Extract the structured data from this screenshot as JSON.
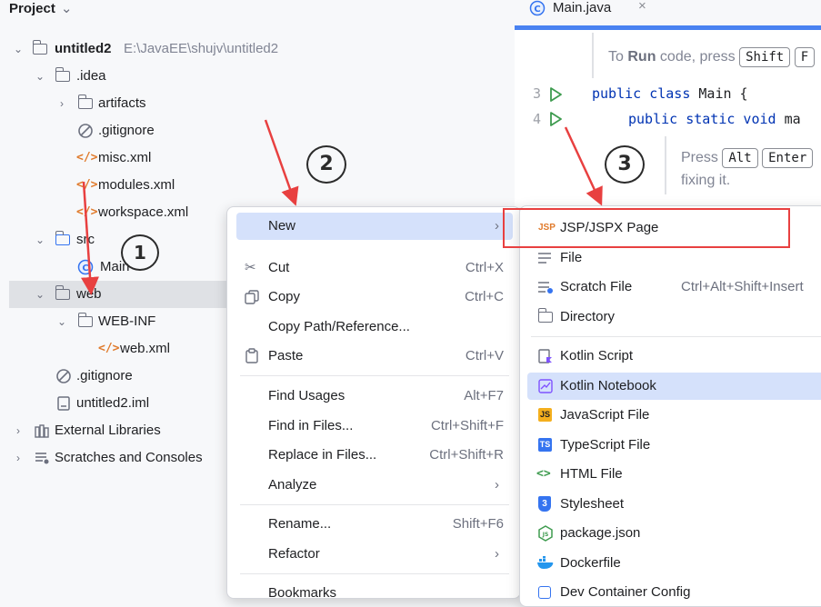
{
  "project_panel": {
    "title": "Project",
    "tree": {
      "root_name": "untitled2",
      "root_path": "E:\\JavaEE\\shujv\\untitled2",
      "idea": ".idea",
      "artifacts": "artifacts",
      "gitignore_idea": ".gitignore",
      "misc": "misc.xml",
      "modules": "modules.xml",
      "workspace": "workspace.xml",
      "src": "src",
      "main": "Main",
      "web": "web",
      "webinf": "WEB-INF",
      "webxml": "web.xml",
      "gitignore_root": ".gitignore",
      "iml": "untitled2.iml",
      "ext_libs": "External Libraries",
      "scratches": "Scratches and Consoles"
    }
  },
  "editor": {
    "tab_label": "Main.java",
    "hint_prefix": "To",
    "hint_run": "Run",
    "hint_mid": "code, press",
    "key_shift": "Shift",
    "key_f": "F",
    "line3_num": "3",
    "line4_num": "4",
    "line3_kw": "public class",
    "line3_rest": "Main {",
    "line4_kw": "public static void",
    "line4_rest": "ma",
    "hint2_prefix": "Press",
    "key_alt": "Alt",
    "key_enter": "Enter",
    "hint2_line2": "fixing it."
  },
  "context_menu": {
    "items": [
      {
        "label": "New",
        "shortcut": ""
      },
      {
        "label": "Cut",
        "shortcut": "Ctrl+X"
      },
      {
        "label": "Copy",
        "shortcut": "Ctrl+C"
      },
      {
        "label": "Copy Path/Reference...",
        "shortcut": ""
      },
      {
        "label": "Paste",
        "shortcut": "Ctrl+V"
      },
      {
        "label": "Find Usages",
        "shortcut": "Alt+F7"
      },
      {
        "label": "Find in Files...",
        "shortcut": "Ctrl+Shift+F"
      },
      {
        "label": "Replace in Files...",
        "shortcut": "Ctrl+Shift+R"
      },
      {
        "label": "Analyze",
        "shortcut": ""
      },
      {
        "label": "Rename...",
        "shortcut": "Shift+F6"
      },
      {
        "label": "Refactor",
        "shortcut": ""
      },
      {
        "label": "Bookmarks",
        "shortcut": ""
      }
    ]
  },
  "new_submenu": {
    "items": [
      {
        "label": "JSP/JSPX Page",
        "shortcut": ""
      },
      {
        "label": "File",
        "shortcut": ""
      },
      {
        "label": "Scratch File",
        "shortcut": "Ctrl+Alt+Shift+Insert"
      },
      {
        "label": "Directory",
        "shortcut": ""
      },
      {
        "label": "Kotlin Script",
        "shortcut": ""
      },
      {
        "label": "Kotlin Notebook",
        "shortcut": ""
      },
      {
        "label": "JavaScript File",
        "shortcut": ""
      },
      {
        "label": "TypeScript File",
        "shortcut": ""
      },
      {
        "label": "HTML File",
        "shortcut": ""
      },
      {
        "label": "Stylesheet",
        "shortcut": ""
      },
      {
        "label": "package.json",
        "shortcut": ""
      },
      {
        "label": "Dockerfile",
        "shortcut": ""
      },
      {
        "label": "Dev Container Config",
        "shortcut": ""
      }
    ],
    "icons": {
      "jsp": "JSP",
      "js": "JS",
      "ts": "TS",
      "css": "3",
      "node": "JS"
    }
  },
  "annotations": {
    "marker_1": "1",
    "marker_2": "2",
    "marker_3": "3",
    "accent_red": "#e84040"
  },
  "colors": {
    "selection": "#d5e1fb",
    "keyword": "#0033b3",
    "run_green": "#3e9b4f"
  }
}
